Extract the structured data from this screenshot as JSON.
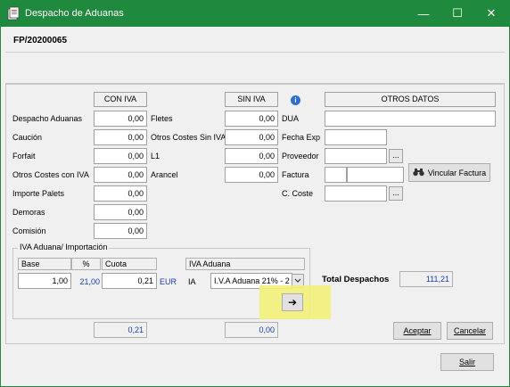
{
  "window": {
    "title": "Despacho de Aduanas",
    "min_glyph": "—",
    "max_glyph": "☐",
    "close_glyph": "✕"
  },
  "header": {
    "record_id": "FP/20200065"
  },
  "columns": {
    "con_iva": "CON IVA",
    "sin_iva": "SIN IVA",
    "otros_datos": "OTROS DATOS",
    "info_glyph": "i"
  },
  "con_iva_rows": [
    {
      "label": "Despacho Aduanas",
      "value": "0,00"
    },
    {
      "label": "Caución",
      "value": "0,00"
    },
    {
      "label": "Forfait",
      "value": "0,00"
    },
    {
      "label": "Otros Costes con IVA",
      "value": "0,00"
    },
    {
      "label": "Importe Palets",
      "value": "0,00"
    },
    {
      "label": "Demoras",
      "value": "0,00"
    },
    {
      "label": "Comisión",
      "value": "0,00"
    }
  ],
  "sin_iva_rows": [
    {
      "label": "Fletes",
      "value": "0,00"
    },
    {
      "label": "Otros Costes Sin IVA",
      "value": "0,00"
    },
    {
      "label": "L1",
      "value": "0,00"
    },
    {
      "label": "Arancel",
      "value": "0,00"
    }
  ],
  "otros_datos": {
    "dua_label": "DUA",
    "dua_value": "",
    "fecha_exp_label": "Fecha Exp",
    "fecha_exp_value": "",
    "proveedor_label": "Proveedor",
    "proveedor_value": "",
    "factura_label": "Factura",
    "factura_value_a": "",
    "factura_value_b": "",
    "c_coste_label": "C. Coste",
    "c_coste_value": "",
    "dots": "...",
    "vincular_label": "Vincular Factura"
  },
  "iva_aduana": {
    "group_title": "IVA Aduana/ Importación",
    "base_header": "Base",
    "pct_header": "%",
    "cuota_header": "Cuota",
    "iva_header": "IVA Aduana",
    "base_value": "1,00",
    "pct_value": "21,00",
    "cuota_value": "0,21",
    "currency": "EUR",
    "iva_code": "IA",
    "iva_select": "I.V.A Aduana 21% - 2",
    "arrow_glyph": "➔"
  },
  "totals": {
    "con_iva_total": "0,21",
    "sin_iva_total": "0,00",
    "total_despachos_label": "Total Despachos",
    "total_despachos_value": "111,21"
  },
  "buttons": {
    "aceptar": "Aceptar",
    "cancelar": "Cancelar",
    "salir": "Salir"
  },
  "colors": {
    "titlebar": "#1f8a3e",
    "highlight": "#f3f07a",
    "value_blue": "#1a3fb0"
  }
}
